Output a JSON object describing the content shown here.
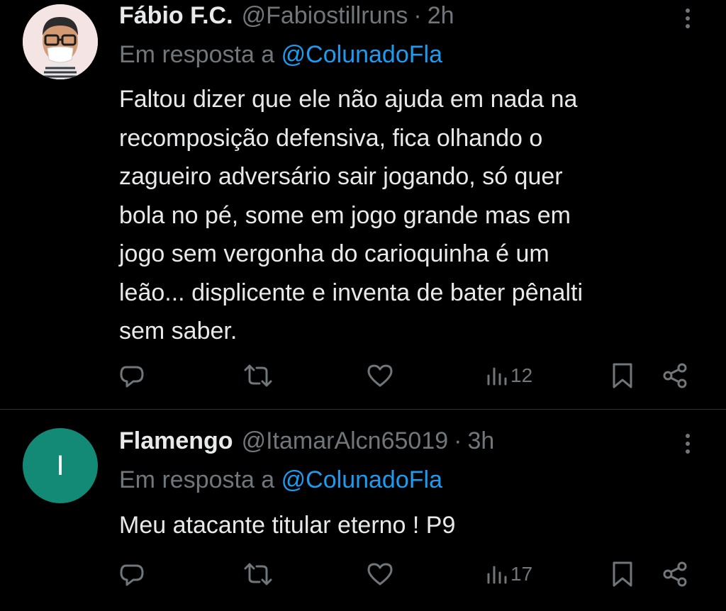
{
  "tweets": [
    {
      "display_name": "Fábio F.C.",
      "handle": "@Fabiostillruns",
      "separator": "·",
      "time": "2h",
      "reply_prefix": "Em resposta a",
      "reply_to": "@ColunadoFla",
      "text": "Faltou dizer que ele não ajuda em nada na\nrecomposição defensiva, fica olhando o\nzagueiro adversário sair jogando, só quer\nbola no pé, some em jogo grande mas em\njogo sem vergonha do carioquinha é um\nleão... displicente e inventa de bater pênalti\nsem saber.",
      "views": "12",
      "avatar_icon": "memoji-avatar-icon"
    },
    {
      "display_name": "Flamengo",
      "handle": "@ItamarAlcn65019",
      "separator": "·",
      "time": "3h",
      "reply_prefix": "Em resposta a",
      "reply_to": "@ColunadoFla",
      "text": "Meu atacante titular eterno ! P9",
      "views": "17",
      "avatar_letter": "I",
      "avatar_color": "#128a76"
    }
  ],
  "colors": {
    "background": "#000000",
    "text": "#e7e9ea",
    "muted": "#71767b",
    "link": "#1d9bf0",
    "divider": "#2f3336"
  },
  "icons": [
    "reply-icon",
    "retweet-icon",
    "like-icon",
    "views-icon",
    "bookmark-icon",
    "share-icon",
    "more-icon"
  ]
}
